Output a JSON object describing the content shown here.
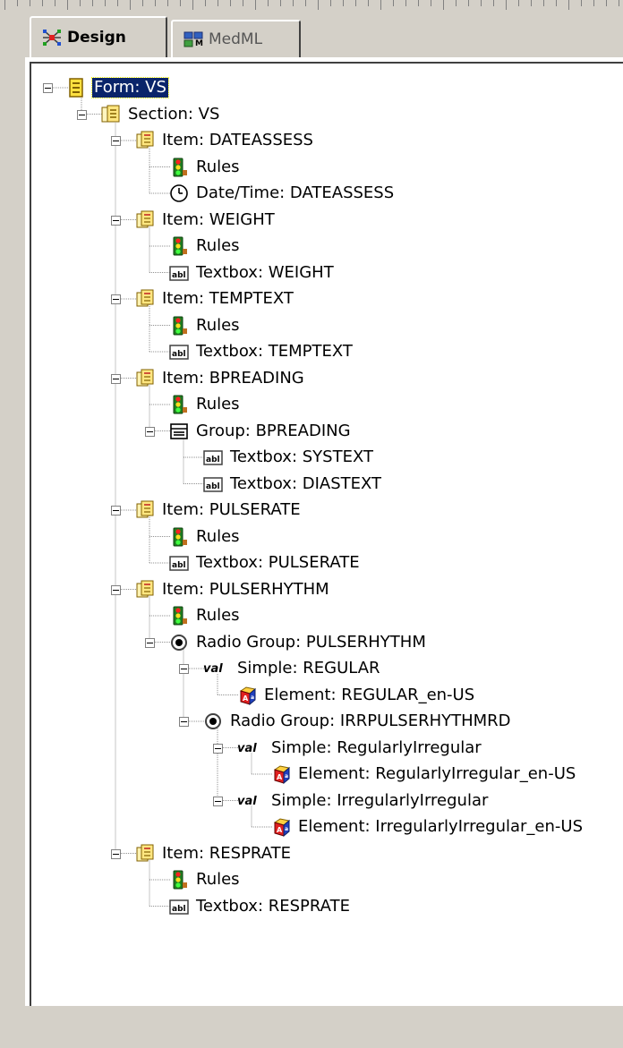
{
  "tabs": [
    {
      "label": "Design",
      "icon": "design-icon",
      "active": true
    },
    {
      "label": "MedML",
      "icon": "medml-icon",
      "active": false
    }
  ],
  "tree": [
    {
      "label": "Form: VS",
      "icon": "form-icon",
      "depth": 0,
      "toggle": true,
      "selected": true
    },
    {
      "label": "Section: VS",
      "icon": "section-icon",
      "depth": 1,
      "toggle": true
    },
    {
      "label": "Item: DATEASSESS",
      "icon": "item-icon",
      "depth": 2,
      "toggle": true
    },
    {
      "label": "Rules",
      "icon": "rules-icon",
      "depth": 3
    },
    {
      "label": "Date/Time: DATEASSESS",
      "icon": "clock-icon",
      "depth": 3
    },
    {
      "label": "Item: WEIGHT",
      "icon": "item-icon",
      "depth": 2,
      "toggle": true
    },
    {
      "label": "Rules",
      "icon": "rules-icon",
      "depth": 3
    },
    {
      "label": "Textbox: WEIGHT",
      "icon": "textbox-icon",
      "depth": 3
    },
    {
      "label": "Item: TEMPTEXT",
      "icon": "item-icon",
      "depth": 2,
      "toggle": true
    },
    {
      "label": "Rules",
      "icon": "rules-icon",
      "depth": 3
    },
    {
      "label": "Textbox: TEMPTEXT",
      "icon": "textbox-icon",
      "depth": 3
    },
    {
      "label": "Item: BPREADING",
      "icon": "item-icon",
      "depth": 2,
      "toggle": true
    },
    {
      "label": "Rules",
      "icon": "rules-icon",
      "depth": 3
    },
    {
      "label": "Group: BPREADING",
      "icon": "group-icon",
      "depth": 3,
      "toggle": true
    },
    {
      "label": "Textbox: SYSTEXT",
      "icon": "textbox-icon",
      "depth": 4
    },
    {
      "label": "Textbox: DIASTEXT",
      "icon": "textbox-icon",
      "depth": 4
    },
    {
      "label": "Item: PULSERATE",
      "icon": "item-icon",
      "depth": 2,
      "toggle": true
    },
    {
      "label": "Rules",
      "icon": "rules-icon",
      "depth": 3
    },
    {
      "label": "Textbox: PULSERATE",
      "icon": "textbox-icon",
      "depth": 3
    },
    {
      "label": "Item: PULSERHYTHM",
      "icon": "item-icon",
      "depth": 2,
      "toggle": true
    },
    {
      "label": "Rules",
      "icon": "rules-icon",
      "depth": 3
    },
    {
      "label": "Radio Group: PULSERHYTHM",
      "icon": "radio-icon",
      "depth": 3,
      "toggle": true
    },
    {
      "label": "Simple: REGULAR",
      "icon": "val-icon",
      "depth": 4,
      "toggle": true
    },
    {
      "label": "Element: REGULAR_en-US",
      "icon": "element-icon",
      "depth": 5
    },
    {
      "label": "Radio Group: IRRPULSERHYTHMRD",
      "icon": "radio-icon",
      "depth": 4,
      "toggle": true
    },
    {
      "label": "Simple: RegularlyIrregular",
      "icon": "val-icon",
      "depth": 5,
      "toggle": true
    },
    {
      "label": "Element: RegularlyIrregular_en-US",
      "icon": "element-icon",
      "depth": 6
    },
    {
      "label": "Simple: IrregularlyIrregular",
      "icon": "val-icon",
      "depth": 5,
      "toggle": true
    },
    {
      "label": "Element: IrregularlyIrregular_en-US",
      "icon": "element-icon",
      "depth": 6
    },
    {
      "label": "Item: RESPRATE",
      "icon": "item-icon",
      "depth": 2,
      "toggle": true
    },
    {
      "label": "Rules",
      "icon": "rules-icon",
      "depth": 3
    },
    {
      "label": "Textbox: RESPRATE",
      "icon": "textbox-icon",
      "depth": 3
    }
  ],
  "colors": {
    "selection_bg": "#0a246a",
    "window_bg": "#d4d0c8",
    "tree_bg": "#ffffff"
  }
}
